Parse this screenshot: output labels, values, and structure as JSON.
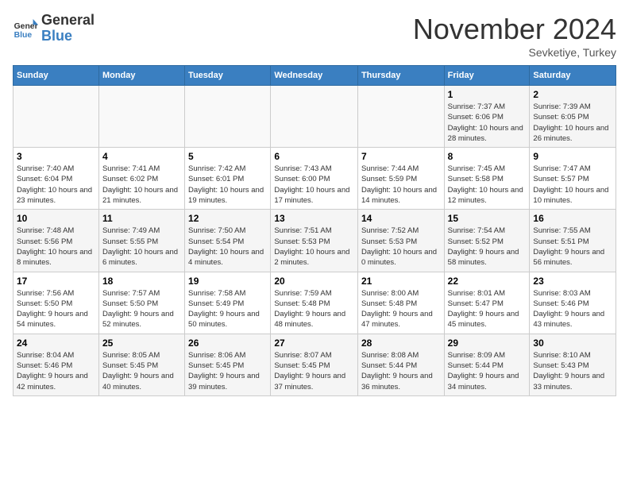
{
  "header": {
    "logo_general": "General",
    "logo_blue": "Blue",
    "month_title": "November 2024",
    "location": "Sevketiye, Turkey"
  },
  "days_of_week": [
    "Sunday",
    "Monday",
    "Tuesday",
    "Wednesday",
    "Thursday",
    "Friday",
    "Saturday"
  ],
  "weeks": [
    [
      {
        "day": "",
        "info": ""
      },
      {
        "day": "",
        "info": ""
      },
      {
        "day": "",
        "info": ""
      },
      {
        "day": "",
        "info": ""
      },
      {
        "day": "",
        "info": ""
      },
      {
        "day": "1",
        "info": "Sunrise: 7:37 AM\nSunset: 6:06 PM\nDaylight: 10 hours and 28 minutes."
      },
      {
        "day": "2",
        "info": "Sunrise: 7:39 AM\nSunset: 6:05 PM\nDaylight: 10 hours and 26 minutes."
      }
    ],
    [
      {
        "day": "3",
        "info": "Sunrise: 7:40 AM\nSunset: 6:04 PM\nDaylight: 10 hours and 23 minutes."
      },
      {
        "day": "4",
        "info": "Sunrise: 7:41 AM\nSunset: 6:02 PM\nDaylight: 10 hours and 21 minutes."
      },
      {
        "day": "5",
        "info": "Sunrise: 7:42 AM\nSunset: 6:01 PM\nDaylight: 10 hours and 19 minutes."
      },
      {
        "day": "6",
        "info": "Sunrise: 7:43 AM\nSunset: 6:00 PM\nDaylight: 10 hours and 17 minutes."
      },
      {
        "day": "7",
        "info": "Sunrise: 7:44 AM\nSunset: 5:59 PM\nDaylight: 10 hours and 14 minutes."
      },
      {
        "day": "8",
        "info": "Sunrise: 7:45 AM\nSunset: 5:58 PM\nDaylight: 10 hours and 12 minutes."
      },
      {
        "day": "9",
        "info": "Sunrise: 7:47 AM\nSunset: 5:57 PM\nDaylight: 10 hours and 10 minutes."
      }
    ],
    [
      {
        "day": "10",
        "info": "Sunrise: 7:48 AM\nSunset: 5:56 PM\nDaylight: 10 hours and 8 minutes."
      },
      {
        "day": "11",
        "info": "Sunrise: 7:49 AM\nSunset: 5:55 PM\nDaylight: 10 hours and 6 minutes."
      },
      {
        "day": "12",
        "info": "Sunrise: 7:50 AM\nSunset: 5:54 PM\nDaylight: 10 hours and 4 minutes."
      },
      {
        "day": "13",
        "info": "Sunrise: 7:51 AM\nSunset: 5:53 PM\nDaylight: 10 hours and 2 minutes."
      },
      {
        "day": "14",
        "info": "Sunrise: 7:52 AM\nSunset: 5:53 PM\nDaylight: 10 hours and 0 minutes."
      },
      {
        "day": "15",
        "info": "Sunrise: 7:54 AM\nSunset: 5:52 PM\nDaylight: 9 hours and 58 minutes."
      },
      {
        "day": "16",
        "info": "Sunrise: 7:55 AM\nSunset: 5:51 PM\nDaylight: 9 hours and 56 minutes."
      }
    ],
    [
      {
        "day": "17",
        "info": "Sunrise: 7:56 AM\nSunset: 5:50 PM\nDaylight: 9 hours and 54 minutes."
      },
      {
        "day": "18",
        "info": "Sunrise: 7:57 AM\nSunset: 5:50 PM\nDaylight: 9 hours and 52 minutes."
      },
      {
        "day": "19",
        "info": "Sunrise: 7:58 AM\nSunset: 5:49 PM\nDaylight: 9 hours and 50 minutes."
      },
      {
        "day": "20",
        "info": "Sunrise: 7:59 AM\nSunset: 5:48 PM\nDaylight: 9 hours and 48 minutes."
      },
      {
        "day": "21",
        "info": "Sunrise: 8:00 AM\nSunset: 5:48 PM\nDaylight: 9 hours and 47 minutes."
      },
      {
        "day": "22",
        "info": "Sunrise: 8:01 AM\nSunset: 5:47 PM\nDaylight: 9 hours and 45 minutes."
      },
      {
        "day": "23",
        "info": "Sunrise: 8:03 AM\nSunset: 5:46 PM\nDaylight: 9 hours and 43 minutes."
      }
    ],
    [
      {
        "day": "24",
        "info": "Sunrise: 8:04 AM\nSunset: 5:46 PM\nDaylight: 9 hours and 42 minutes."
      },
      {
        "day": "25",
        "info": "Sunrise: 8:05 AM\nSunset: 5:45 PM\nDaylight: 9 hours and 40 minutes."
      },
      {
        "day": "26",
        "info": "Sunrise: 8:06 AM\nSunset: 5:45 PM\nDaylight: 9 hours and 39 minutes."
      },
      {
        "day": "27",
        "info": "Sunrise: 8:07 AM\nSunset: 5:45 PM\nDaylight: 9 hours and 37 minutes."
      },
      {
        "day": "28",
        "info": "Sunrise: 8:08 AM\nSunset: 5:44 PM\nDaylight: 9 hours and 36 minutes."
      },
      {
        "day": "29",
        "info": "Sunrise: 8:09 AM\nSunset: 5:44 PM\nDaylight: 9 hours and 34 minutes."
      },
      {
        "day": "30",
        "info": "Sunrise: 8:10 AM\nSunset: 5:43 PM\nDaylight: 9 hours and 33 minutes."
      }
    ]
  ]
}
